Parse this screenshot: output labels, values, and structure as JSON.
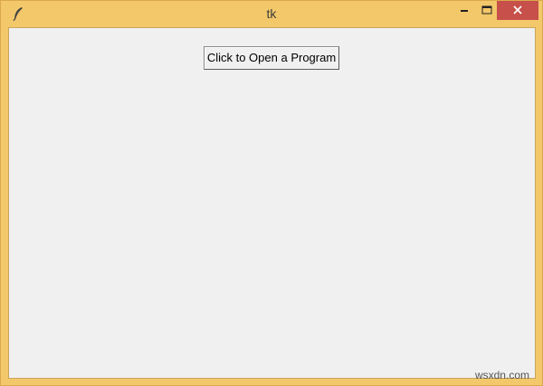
{
  "window": {
    "title": "tk",
    "app_icon": "feather-icon",
    "controls": {
      "minimize_icon": "minimize-icon",
      "maximize_icon": "maximize-icon",
      "close_icon": "close-icon",
      "close_color": "#c7504a"
    },
    "frame_color": "#f3c86a"
  },
  "main": {
    "button_label": "Click to Open a Program"
  },
  "watermark": "wsxdn.com"
}
